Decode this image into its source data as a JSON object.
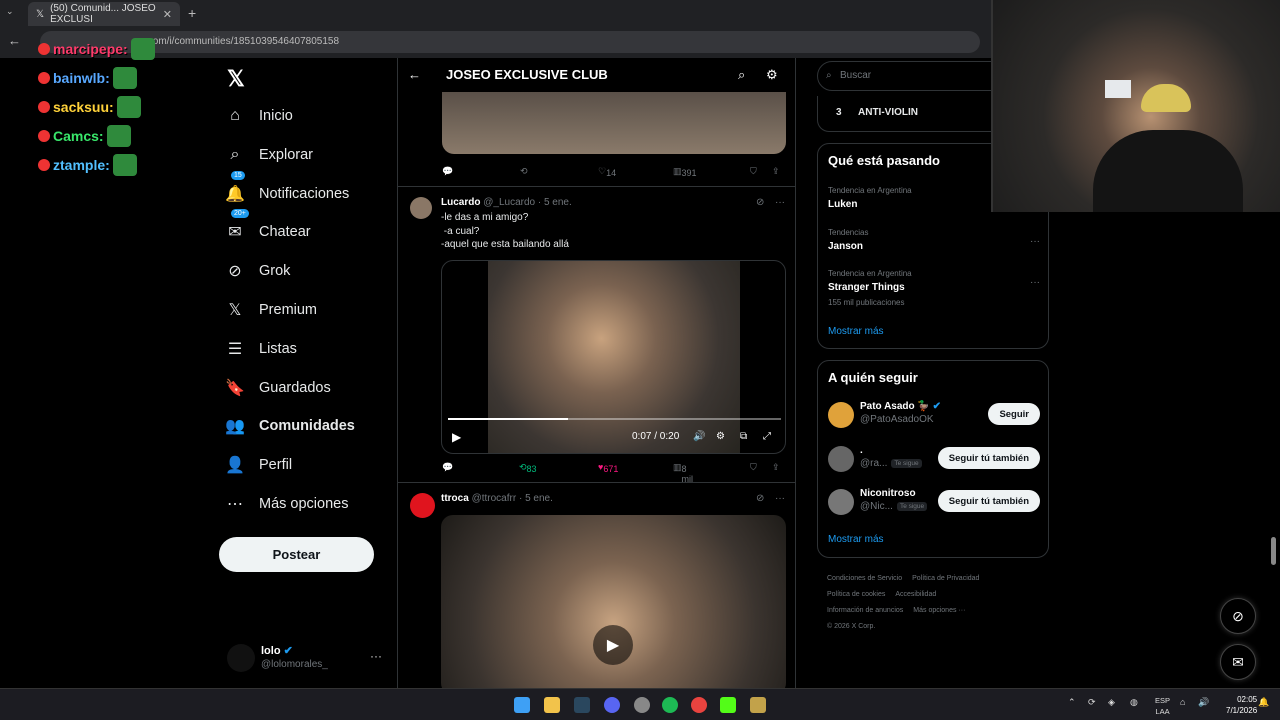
{
  "browser": {
    "tab_title": "(50) Comunid... JOSEO EXCLUSI",
    "tab_close": "✕",
    "new_tab": "+",
    "url": "x.com/i/communities/1851039546407805158"
  },
  "stream_chat": [
    {
      "user": "marcipepe:",
      "color": "#ff3b6b"
    },
    {
      "user": "bainwlb:",
      "color": "#58a8ff"
    },
    {
      "user": "sacksuu:",
      "color": "#ffd23a"
    },
    {
      "user": "Camcs:",
      "color": "#39e66b"
    },
    {
      "user": "ztample:",
      "color": "#52c0ff"
    }
  ],
  "nav": {
    "logo": "𝕏",
    "items": [
      {
        "label": "Inicio",
        "icon": "⌂",
        "bold": false
      },
      {
        "label": "Explorar",
        "icon": "⌕",
        "bold": false
      },
      {
        "label": "Notificaciones",
        "icon": "🔔",
        "count": "15"
      },
      {
        "label": "Chatear",
        "icon": "✉",
        "count": "20+"
      },
      {
        "label": "Grok",
        "icon": "⊘"
      },
      {
        "label": "Premium",
        "icon": "𝕏"
      },
      {
        "label": "Listas",
        "icon": "☰"
      },
      {
        "label": "Guardados",
        "icon": "🔖"
      },
      {
        "label": "Comunidades",
        "icon": "👥",
        "bold": true
      },
      {
        "label": "Perfil",
        "icon": "👤"
      },
      {
        "label": "Más opciones",
        "icon": "⋯"
      }
    ],
    "post_button": "Postear",
    "account": {
      "name": "lolo",
      "handle": "@lolomorales_",
      "more": "···"
    }
  },
  "feed": {
    "header": {
      "title": "JOSEO EXCLUSIVE CLUB",
      "back": "←"
    },
    "tweet0": {
      "replies": "",
      "retweets": "",
      "likes": "14",
      "views": "391"
    },
    "tweet1": {
      "name": "Lucardo",
      "meta": "@_Lucardo · 5 ene.",
      "text": "-le das a mi amigo?\n -a cual?\n-aquel que esta bailando allá",
      "time": "0:07 / 0:20",
      "retweets": "83",
      "likes": "671",
      "views": "8 mil"
    },
    "tweet2": {
      "name": "ttroca",
      "meta": "@ttrocafrr · 5 ene."
    }
  },
  "right": {
    "search_placeholder": "Buscar",
    "trend_top": {
      "rank": "3",
      "name": "ANTI-VIOLIN"
    },
    "trending": {
      "title": "Qué está pasando",
      "items": [
        {
          "context": "Tendencia en Argentina",
          "name": "Luken",
          "posts": ""
        },
        {
          "context": "Tendencias",
          "name": "Janson",
          "posts": ""
        },
        {
          "context": "Tendencia en Argentina",
          "name": "Stranger Things",
          "posts": "155 mil publicaciones"
        }
      ],
      "more": "Mostrar más"
    },
    "follow": {
      "title": "A quién seguir",
      "items": [
        {
          "name": "Pato Asado 🦆",
          "handle": "@PatoAsadoOK",
          "follows_you": "",
          "button": "Seguir"
        },
        {
          "name": ".",
          "handle": "@ra...",
          "follows_you": "Te sigue",
          "button": "Seguir tú también"
        },
        {
          "name": "Niconitroso",
          "handle": "@Nic...",
          "follows_you": "Te sigue",
          "button": "Seguir tú también"
        }
      ],
      "more": "Mostrar más"
    },
    "footer": [
      "Condiciones de Servicio",
      "Política de Privacidad",
      "Política de cookies",
      "Accesibilidad",
      "Información de anuncios",
      "Más opciones ···",
      "© 2026 X Corp."
    ]
  },
  "taskbar": {
    "lang_top": "ESP",
    "lang_bottom": "LAA",
    "time": "02:05",
    "date": "7/1/2026"
  },
  "colors": {
    "accent": "#1d9bf0",
    "like": "#f91880",
    "retweet": "#00ba7c"
  }
}
